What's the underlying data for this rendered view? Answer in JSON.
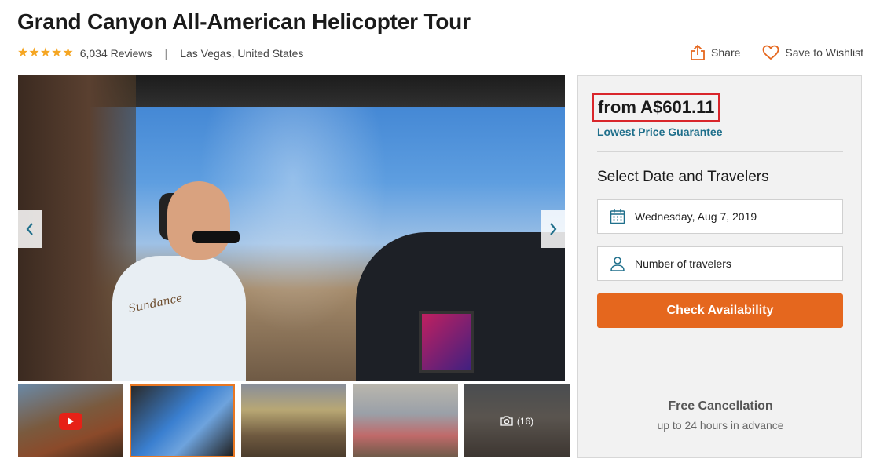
{
  "page": {
    "title": "Grand Canyon All-American Helicopter Tour",
    "rating_stars": 5,
    "reviews": "6,034 Reviews",
    "separator": "|",
    "location": "Las Vegas, United States"
  },
  "actions": {
    "share_label": "Share",
    "wishlist_label": "Save to Wishlist"
  },
  "gallery": {
    "main_photo_caption": "Sundance",
    "prev_icon": "chevron-left-icon",
    "next_icon": "chevron-right-icon",
    "thumbnails": [
      {
        "kind": "video",
        "icon": "play-icon"
      },
      {
        "kind": "photo",
        "active": true
      },
      {
        "kind": "photo"
      },
      {
        "kind": "photo"
      },
      {
        "kind": "more",
        "icon": "camera-icon",
        "count_label": "(16)"
      }
    ]
  },
  "booking": {
    "price": "from A$601.11",
    "price_guarantee": "Lowest Price Guarantee",
    "select_title": "Select Date and Travelers",
    "date_value": "Wednesday, Aug 7, 2019",
    "travelers_placeholder": "Number of travelers",
    "check_label": "Check Availability",
    "free_cancel_title": "Free Cancellation",
    "free_cancel_sub": "up to 24 hours in advance"
  },
  "colors": {
    "star": "#f5a623",
    "accent_orange": "#e5671e",
    "link_blue": "#1f6f8b",
    "price_highlight": "#d9262b"
  }
}
